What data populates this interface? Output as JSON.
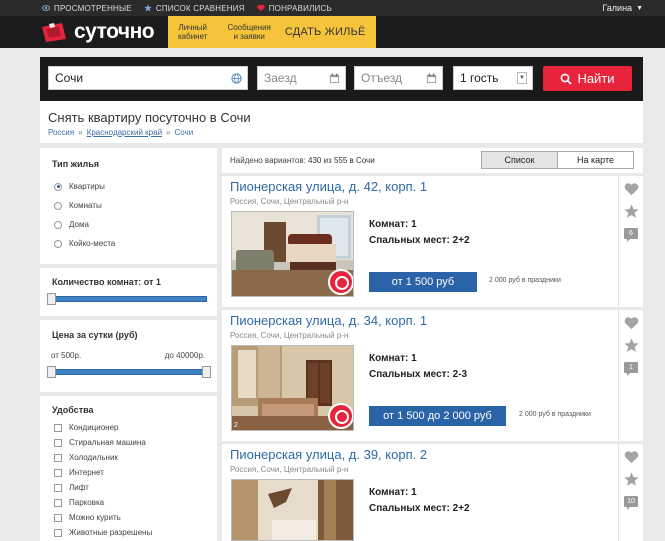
{
  "topbar": {
    "viewed": "ПРОСМОТРЕННЫЕ",
    "compare": "СПИСОК СРАВНЕНИЯ",
    "liked": "ПОНРАВИЛИСЬ",
    "user": "Галина"
  },
  "header": {
    "logo": "суточно",
    "nav_cabinet_1": "Личный",
    "nav_cabinet_2": "кабинет",
    "nav_messages_1": "Сообщения",
    "nav_messages_2": "и заявки",
    "sell": "СДАТЬ ЖИЛЬЁ"
  },
  "search": {
    "city": "Сочи",
    "checkin_placeholder": "Заезд",
    "checkout_placeholder": "Отъезд",
    "guests": "1 гость",
    "find": "Найти"
  },
  "page": {
    "title": "Снять квартиру посуточно в Сочи",
    "breadcrumbs": [
      "Россия",
      "Краснодарский край",
      "Сочи"
    ]
  },
  "filters": {
    "type_title": "Тип жилья",
    "types": [
      "Квартиры",
      "Комнаты",
      "Дома",
      "Койко-места"
    ],
    "rooms_title": "Количество комнат: от 1",
    "price_title": "Цена за сутки (руб)",
    "price_from": "от 500р.",
    "price_to": "до 40000р.",
    "amenities_title": "Удобства",
    "amenities": [
      "Кондиционер",
      "Стиральная машина",
      "Холодильник",
      "Интернет",
      "Лифт",
      "Парковка",
      "Можно курить",
      "Животные разрешены"
    ]
  },
  "results": {
    "found_label": "Найдено вариантов:",
    "found_value": "430 из 555 в Сочи",
    "view_list": "Список",
    "view_map": "На карте"
  },
  "listings": [
    {
      "title": "Пионерская улица, д. 42, корп. 1",
      "location": "Россия, Сочи, Центральный р-н",
      "rooms": "Комнат: 1",
      "beds": "Спальных мест: 2+2",
      "price": "от 1 500 руб",
      "holiday": "2 000 руб в праздники",
      "reviews": "6"
    },
    {
      "title": "Пионерская улица, д. 34, корп. 1",
      "location": "Россия, Сочи, Центральный р-н",
      "rooms": "Комнат: 1",
      "beds": "Спальных мест: 2-3",
      "price": "от 1 500 до 2 000 руб",
      "holiday": "2 000 руб в праздники",
      "reviews": "1",
      "photo_count": "2"
    },
    {
      "title": "Пионерская улица, д. 39, корп. 2",
      "location": "Россия, Сочи, Центральный р-н",
      "rooms": "Комнат: 1",
      "beds": "Спальных мест: 2+2",
      "reviews": "10"
    }
  ],
  "colors": {
    "accent_red": "#e8243c",
    "yellow": "#f5c43a",
    "link_blue": "#2f6aa7",
    "price_blue": "#2a63a8"
  }
}
